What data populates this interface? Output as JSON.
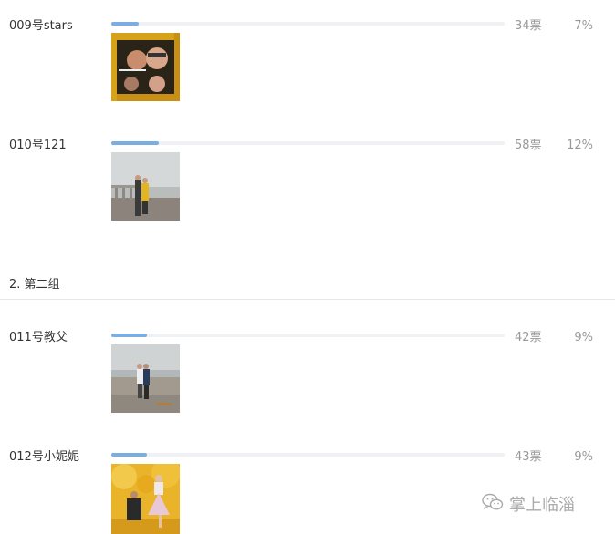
{
  "groups": [
    {
      "entries": [
        {
          "name": "009号stars",
          "votes": "34票",
          "percent": "7%",
          "progress": 0.07,
          "photo_icon": "couple-photo-icon"
        },
        {
          "name": "010号121",
          "votes": "58票",
          "percent": "12%",
          "progress": 0.12,
          "photo_icon": "couple-photo-icon"
        }
      ]
    },
    {
      "title": "2. 第二组",
      "entries": [
        {
          "name": "011号教父",
          "votes": "42票",
          "percent": "9%",
          "progress": 0.09,
          "photo_icon": "couple-photo-icon"
        },
        {
          "name": "012号小妮妮",
          "votes": "43票",
          "percent": "9%",
          "progress": 0.09,
          "photo_icon": "couple-photo-icon"
        }
      ]
    }
  ],
  "watermark": {
    "text": "掌上临淄",
    "icon": "wechat-icon"
  },
  "colors": {
    "bar_fill": "#7aaee0",
    "bar_track": "#f0f1f5",
    "muted_text": "#999999"
  }
}
